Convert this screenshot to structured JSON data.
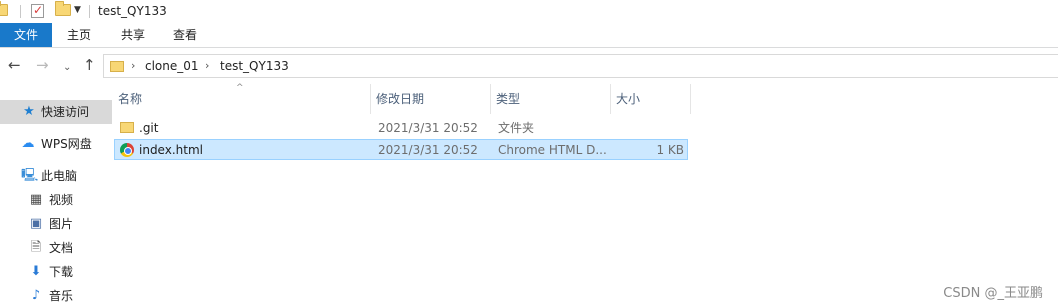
{
  "window": {
    "title": "test_QY133"
  },
  "ribbon": {
    "tabs": [
      "文件",
      "主页",
      "共享",
      "查看"
    ]
  },
  "navigation": {
    "back_glyph": "←",
    "forward_glyph": "→",
    "recent_glyph": "⌄",
    "up_glyph": "↑",
    "breadcrumb_separator": "›",
    "breadcrumb": [
      "clone_01",
      "test_QY133"
    ]
  },
  "sidebar": {
    "items": [
      {
        "label": "快速访问",
        "icon": "star-icon",
        "glyph": "★",
        "color": "#1f7fd1"
      },
      {
        "label": "WPS网盘",
        "icon": "cloud-icon",
        "glyph": "☁",
        "color": "#2b8cf0"
      },
      {
        "label": "此电脑",
        "icon": "computer-icon",
        "glyph": "🖳",
        "color": "#3a8ed8"
      },
      {
        "label": "视频",
        "icon": "video-icon",
        "glyph": "▦",
        "color": "#4b4b4b"
      },
      {
        "label": "图片",
        "icon": "picture-icon",
        "glyph": "▣",
        "color": "#4b6fa5"
      },
      {
        "label": "文档",
        "icon": "document-icon",
        "glyph": "🗎",
        "color": "#5a5a5a"
      },
      {
        "label": "下载",
        "icon": "download-icon",
        "glyph": "⬇",
        "color": "#2a7bd6"
      },
      {
        "label": "音乐",
        "icon": "music-icon",
        "glyph": "♪",
        "color": "#2a7bd6"
      }
    ]
  },
  "file_list": {
    "columns": [
      "名称",
      "修改日期",
      "类型",
      "大小"
    ],
    "sort_indicator": "^",
    "rows": [
      {
        "name": ".git",
        "modified": "2021/3/31 20:52",
        "type": "文件夹",
        "size": "",
        "icon": "folder-icon"
      },
      {
        "name": "index.html",
        "modified": "2021/3/31 20:52",
        "type": "Chrome HTML D...",
        "size": "1 KB",
        "icon": "chrome-icon"
      }
    ],
    "selected_row": "index.html"
  },
  "watermark": "CSDN @_王亚鹏",
  "colors": {
    "accent": "#1979ca",
    "selection_bg": "#cce8ff",
    "selection_border": "#99d1ff",
    "folder": "#f8d775"
  }
}
